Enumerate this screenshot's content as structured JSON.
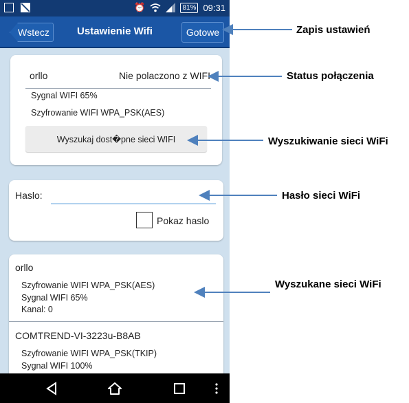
{
  "status_bar": {
    "battery": "81%",
    "time": "09:31"
  },
  "title_bar": {
    "back_label": "Wstecz",
    "title": "Ustawienie Wifi",
    "done_label": "Gotowe"
  },
  "connection": {
    "network_name": "orllo",
    "status": "Nie polaczono z WIFI",
    "signal": "Sygnal WIFI   65%",
    "encryption": "Szyfrowanie WIFI   WPA_PSK(AES)",
    "search_button": "Wyszukaj dost�pne sieci WIFI"
  },
  "password": {
    "label": "Haslo:",
    "value": "",
    "show_label": "Pokaz haslo"
  },
  "networks": [
    {
      "name": "orllo",
      "encryption": "Szyfrowanie WIFI   WPA_PSK(AES)",
      "signal": "Sygnal WIFI   65%",
      "channel": "Kanal:   0"
    },
    {
      "name": "COMTREND-VI-3223u-B8AB",
      "encryption": "Szyfrowanie WIFI   WPA_PSK(TKIP)",
      "signal": "Sygnal WIFI   100%"
    }
  ],
  "annotations": {
    "save": "Zapis ustawień",
    "status": "Status połączenia",
    "search": "Wyszukiwanie sieci WiFi",
    "password": "Hasło sieci WiFi",
    "found": "Wyszukane sieci WiFi"
  },
  "colors": {
    "accent": "#1b56a5",
    "arrow": "#4f81bd",
    "input_underline": "#3f8fd6"
  }
}
